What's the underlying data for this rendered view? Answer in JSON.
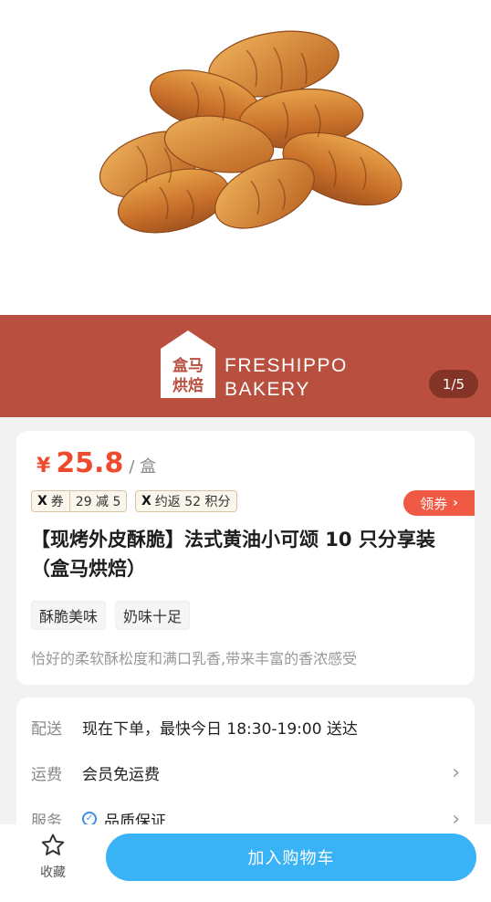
{
  "hero": {
    "image_icon": "croissant-pile-photo",
    "brand_logo_text": "盒马烘焙",
    "brand_line1": "FRESHIPPO",
    "brand_line2": "BAKERY",
    "page_indicator": "1/5"
  },
  "product": {
    "price_currency": "¥",
    "price_value": "25.8",
    "price_unit": "/ 盒",
    "coupons": [
      {
        "icon": "x-coupon-icon",
        "label": "券",
        "value": "29 减 5"
      },
      {
        "icon": "x-points-icon",
        "label": "约返 52 积分"
      }
    ],
    "claim_label": "领券",
    "title": "【现烤外皮酥脆】法式黄油小可颂 10 只分享装（盒马烘焙）",
    "features": [
      "酥脆美味",
      "奶味十足"
    ],
    "description": "恰好的柔软酥松度和满口乳香,带来丰富的香浓感受"
  },
  "delivery": {
    "rows": [
      {
        "label": "配送",
        "value": "现在下单，最快今日 18:30-19:00 送达"
      },
      {
        "label": "运费",
        "value": "会员免运费"
      },
      {
        "label": "服务",
        "value": "品质保证"
      }
    ]
  },
  "bottom_bar": {
    "favorite_label": "收藏",
    "cart_label": "加入购物车"
  },
  "colors": {
    "brand_band": "#b94f3f",
    "price": "#ef4a2e",
    "cart_button": "#39b3f5",
    "claim_button": "#f05a45"
  }
}
